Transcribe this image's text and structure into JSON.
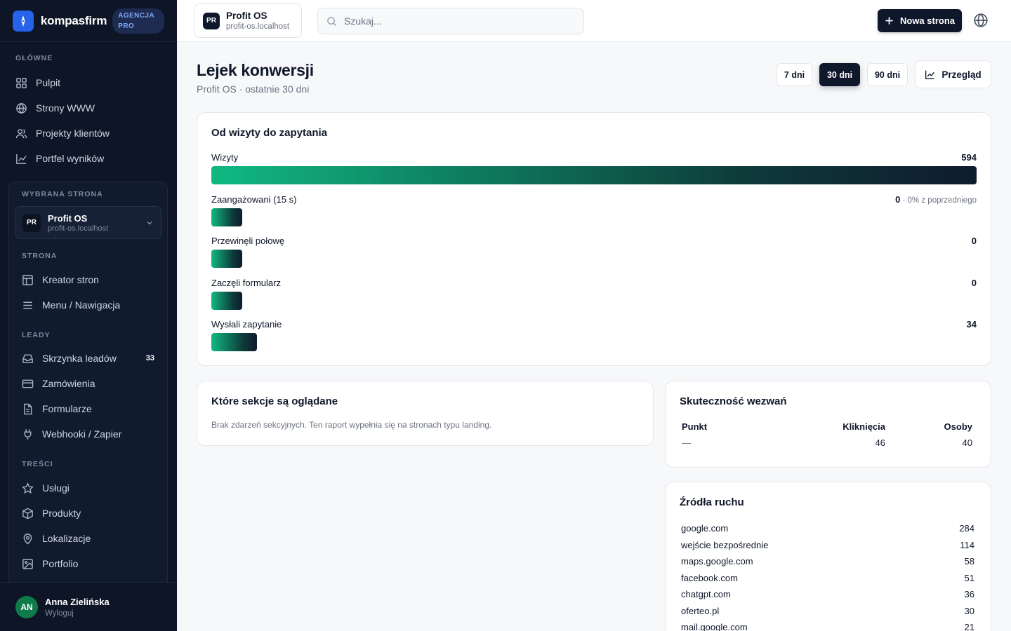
{
  "brand": {
    "name": "kompasfirm",
    "badge": "AGENCJA PRO"
  },
  "sidebar": {
    "main_section": "GŁÓWNE",
    "main_items": [
      {
        "label": "Pulpit",
        "icon": "grid-icon"
      },
      {
        "label": "Strony WWW",
        "icon": "globe-icon"
      },
      {
        "label": "Projekty klientów",
        "icon": "users-icon"
      },
      {
        "label": "Portfel wyników",
        "icon": "chart-line-icon"
      }
    ],
    "selected_site_section": "WYBRANA STRONA",
    "selected_site": {
      "initials": "PR",
      "name": "Profit OS",
      "domain": "profit-os.localhost"
    },
    "page_section": "STRONA",
    "page_items": [
      {
        "label": "Kreator stron",
        "icon": "layout-icon"
      },
      {
        "label": "Menu / Nawigacja",
        "icon": "menu-icon"
      }
    ],
    "leads_section": "LEADY",
    "lead_items": [
      {
        "label": "Skrzynka leadów",
        "icon": "inbox-icon",
        "count": "33"
      },
      {
        "label": "Zamówienia",
        "icon": "card-icon"
      },
      {
        "label": "Formularze",
        "icon": "file-icon"
      },
      {
        "label": "Webhooki / Zapier",
        "icon": "plug-icon"
      }
    ],
    "content_section": "TREŚCI",
    "content_items": [
      {
        "label": "Usługi",
        "icon": "star-icon"
      },
      {
        "label": "Produkty",
        "icon": "box-icon"
      },
      {
        "label": "Lokalizacje",
        "icon": "pin-icon"
      },
      {
        "label": "Portfolio",
        "icon": "image-icon"
      }
    ],
    "user": {
      "initials": "AN",
      "name": "Anna Zielińska",
      "logout": "Wyloguj"
    }
  },
  "header": {
    "site": {
      "initials": "PR",
      "name": "Profit OS",
      "domain": "profit-os.localhost"
    },
    "search_placeholder": "Szukaj...",
    "new_button": "Nowa strona"
  },
  "page": {
    "title": "Lejek konwersji",
    "subtitle": "Profit OS · ostatnie 30 dni",
    "ranges": [
      "7 dni",
      "30 dni",
      "90 dni"
    ],
    "active_range": "30 dni",
    "overview_button": "Przegląd"
  },
  "funnel": {
    "title": "Od wizyty do zapytania",
    "steps": [
      {
        "label": "Wizyty",
        "value": "594",
        "fill": 1.0
      },
      {
        "label": "Zaangażowani (15 s)",
        "value": "0",
        "note": " · 0% z poprzedniego",
        "fill": 0.04
      },
      {
        "label": "Przewinęli połowę",
        "value": "0",
        "fill": 0.04
      },
      {
        "label": "Zaczęli formularz",
        "value": "0",
        "fill": 0.04
      },
      {
        "label": "Wysłali zapytanie",
        "value": "34",
        "fill": 0.06
      }
    ]
  },
  "sections": {
    "title": "Które sekcje są oglądane",
    "empty_text": "Brak zdarzeń sekcyjnych. Ten raport wypełnia się na stronach typu landing."
  },
  "cta": {
    "title": "Skuteczność wezwań",
    "columns": [
      "Punkt",
      "Kliknięcia",
      "Osoby"
    ],
    "rows": [
      {
        "point": "—",
        "clicks": "46",
        "people": "40"
      }
    ]
  },
  "sources": {
    "title": "Źródła ruchu",
    "rows": [
      {
        "name": "google.com",
        "value": "284"
      },
      {
        "name": "wejście bezpośrednie",
        "value": "114"
      },
      {
        "name": "maps.google.com",
        "value": "58"
      },
      {
        "name": "facebook.com",
        "value": "51"
      },
      {
        "name": "chatgpt.com",
        "value": "36"
      },
      {
        "name": "oferteo.pl",
        "value": "30"
      },
      {
        "name": "mail.google.com",
        "value": "21"
      }
    ]
  }
}
